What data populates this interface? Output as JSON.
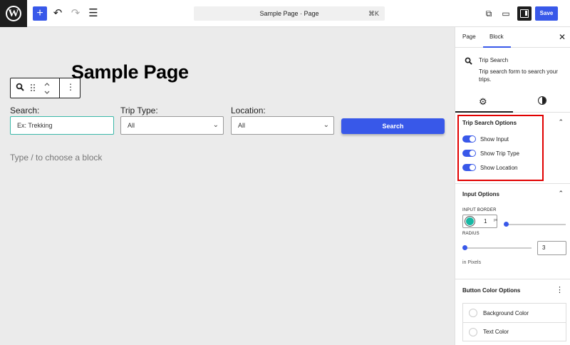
{
  "header": {
    "logo": "W",
    "add_icon": "+",
    "undo_icon": "↶",
    "redo_icon": "↷",
    "list_icon": "☰",
    "doc_title": "Sample Page · Page",
    "shortcut": "⌘K",
    "view_icon": "⧉",
    "device_icon": "▭",
    "save_label": "Save"
  },
  "editor": {
    "page_title": "Sample Page",
    "toolbar": {
      "more_icon": "⋮"
    },
    "form": {
      "search_label": "Search:",
      "search_placeholder": "Ex: Trekking",
      "trip_type_label": "Trip Type:",
      "trip_type_value": "All",
      "location_label": "Location:",
      "location_value": "All",
      "search_button": "Search"
    },
    "block_hint": "Type / to choose a block"
  },
  "sidebar": {
    "tabs": [
      "Page",
      "Block"
    ],
    "active_tab": "Block",
    "close_icon": "✕",
    "block": {
      "name": "Trip Search",
      "description": "Trip search form to search your trips."
    },
    "trip_search_options": {
      "title": "Trip Search Options",
      "toggles": [
        {
          "label": "Show Input",
          "on": true
        },
        {
          "label": "Show Trip Type",
          "on": true
        },
        {
          "label": "Show Location",
          "on": true
        }
      ]
    },
    "input_options": {
      "title": "Input Options",
      "input_border_label": "INPUT BORDER",
      "border_width": "1",
      "border_unit": "px",
      "border_color": "#17b8a4",
      "radius_label": "RADIUS",
      "radius_value": "3",
      "radius_help": "in Pixels"
    },
    "button_color_options": {
      "title": "Button Color Options",
      "items": [
        "Background Color",
        "Text Color"
      ]
    }
  },
  "colors": {
    "accent": "#3858e9",
    "highlight": "#e10000"
  }
}
